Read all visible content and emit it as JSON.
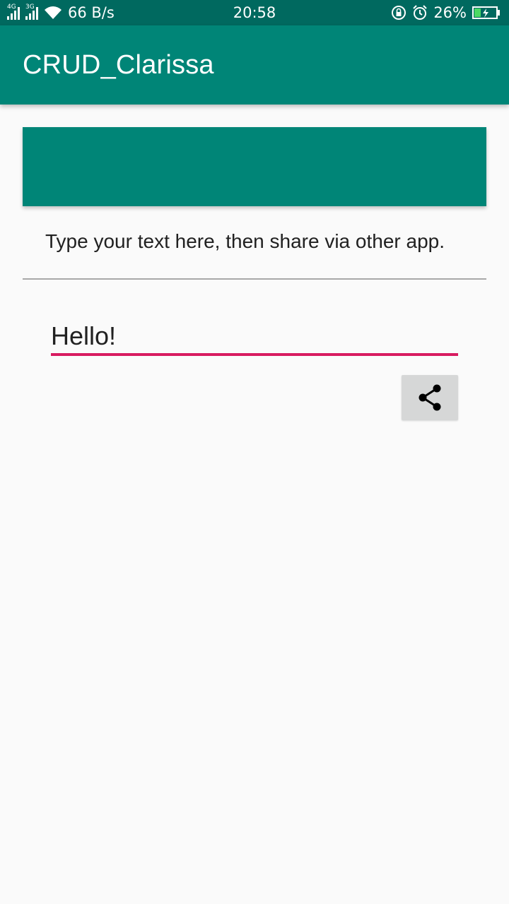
{
  "status_bar": {
    "network_1": "4G",
    "network_2": "3G",
    "speed": "66 B/s",
    "time": "20:58",
    "battery": "26%",
    "icons": [
      "signal-4g-icon",
      "signal-3g-icon",
      "wifi-icon",
      "rotation-lock-icon",
      "alarm-icon",
      "battery-charging-icon"
    ]
  },
  "app_bar": {
    "title": "CRUD_Clarissa"
  },
  "main": {
    "instruction": "Type your text here, then share via other app.",
    "input_value": "Hello!",
    "share_icon": "share-icon"
  },
  "colors": {
    "status_bar": "#00695f",
    "primary": "#008577",
    "accent": "#d81b60",
    "background": "#fafafa",
    "share_button_bg": "#d6d7d7"
  }
}
